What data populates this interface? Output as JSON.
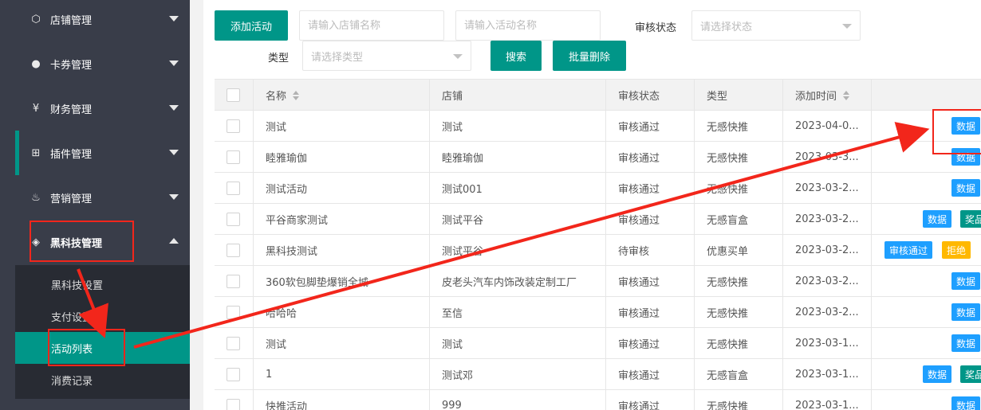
{
  "sidebar": {
    "menu": [
      {
        "label": "店铺管理",
        "icon": "cube-icon",
        "glyph": "⬡"
      },
      {
        "label": "卡券管理",
        "icon": "circle-icon",
        "glyph": "●"
      },
      {
        "label": "财务管理",
        "icon": "yen-icon",
        "glyph": "¥"
      },
      {
        "label": "插件管理",
        "icon": "plugin-icon",
        "glyph": "⊞"
      },
      {
        "label": "营销管理",
        "icon": "fire-icon",
        "glyph": "♨"
      },
      {
        "label": "黑科技管理",
        "icon": "diamond-icon",
        "glyph": "◈"
      }
    ],
    "submenu": [
      {
        "label": "黑科技设置"
      },
      {
        "label": "支付设置"
      },
      {
        "label": "活动列表"
      },
      {
        "label": "消费记录"
      }
    ]
  },
  "toolbar": {
    "add_label": "添加活动",
    "shop_placeholder": "请输入店铺名称",
    "activity_placeholder": "请输入活动名称",
    "review_label": "审核状态",
    "review_placeholder": "请选择状态",
    "type_label": "类型",
    "type_placeholder": "请选择类型",
    "search_label": "搜索",
    "batch_delete_label": "批量删除"
  },
  "table": {
    "headers": {
      "name": "名称",
      "shop": "店铺",
      "review": "审核状态",
      "type": "类型",
      "added": "添加时间"
    },
    "rows": [
      {
        "name": "测试",
        "shop": "测试",
        "review": "审核通过",
        "type": "无感快推",
        "time": "2023-04-0...",
        "actions": [
          "数据"
        ]
      },
      {
        "name": "睦雅瑜伽",
        "shop": "睦雅瑜伽",
        "review": "审核通过",
        "type": "无感快推",
        "time": "2023-03-3...",
        "actions": [
          "数据"
        ]
      },
      {
        "name": "测试活动",
        "shop": "测试001",
        "review": "审核通过",
        "type": "无感快推",
        "time": "2023-03-2...",
        "actions": [
          "数据"
        ]
      },
      {
        "name": "平谷商家测试",
        "shop": "测试平谷",
        "review": "审核通过",
        "type": "无感盲盒",
        "time": "2023-03-2...",
        "actions": [
          "数据",
          "奖品"
        ]
      },
      {
        "name": "黑科技测试",
        "shop": "测试平谷",
        "review": "待审核",
        "type": "优惠买单",
        "time": "2023-03-2...",
        "actions": [
          "审核通过",
          "拒绝"
        ]
      },
      {
        "name": "360软包脚垫爆销全城",
        "shop": "皮老头汽车内饰改装定制工厂",
        "review": "审核通过",
        "type": "无感快推",
        "time": "2023-03-2...",
        "actions": [
          "数据"
        ]
      },
      {
        "name": "哈哈哈",
        "shop": "至信",
        "review": "审核通过",
        "type": "无感快推",
        "time": "2023-03-2...",
        "actions": [
          "数据"
        ]
      },
      {
        "name": "测试",
        "shop": "测试",
        "review": "审核通过",
        "type": "无感快推",
        "time": "2023-03-1...",
        "actions": [
          "数据"
        ]
      },
      {
        "name": "1",
        "shop": "测试邓",
        "review": "审核通过",
        "type": "无感盲盒",
        "time": "2023-03-1...",
        "actions": [
          "数据",
          "奖品"
        ]
      },
      {
        "name": "快推活动",
        "shop": "999",
        "review": "审核通过",
        "type": "无感快推",
        "time": "2023-03-1...",
        "actions": [
          "数据"
        ]
      }
    ]
  },
  "colors": {
    "primary": "#009688",
    "sidebar": "#393d49",
    "submenu": "#282b33",
    "tag_blue": "#1e9fff",
    "tag_orange": "#ffb800",
    "annotation": "#f2261b"
  }
}
